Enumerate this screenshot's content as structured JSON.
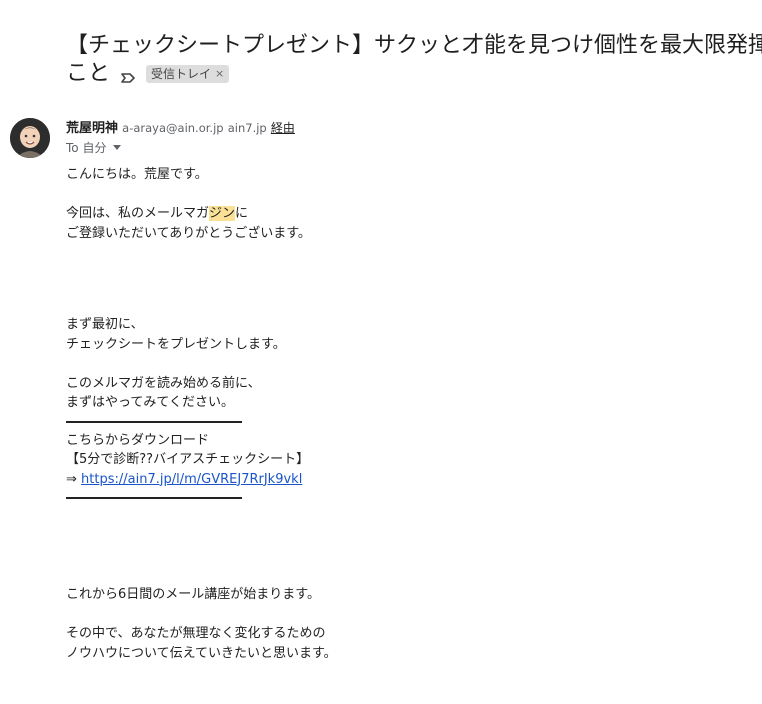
{
  "email": {
    "subject_line1": "【チェックシートプレゼント】サクッと才能を見つけ個性を最大限発揮",
    "subject_line2": "こと",
    "label": "受信トレイ",
    "label_close": "×",
    "sender": {
      "name": "荒屋明神",
      "email": "a-araya@ain.or.jp",
      "via_domain": "ain7.jp",
      "via_label": "経由"
    },
    "to_line": "To 自分",
    "body": {
      "greeting": "こんにちは。荒屋です。",
      "p2_part1": "今回は、私のメールマガ",
      "p2_highlight": "ジン",
      "p2_part2": "に",
      "p2_line2": "ご登録いただいてありがとうございます。",
      "p3_line1": "まず最初に、",
      "p3_line2": "チェックシートをプレゼントします。",
      "p4_line1": "このメルマガを読み始める前に、",
      "p4_line2": "まずはやってみてください。",
      "download_line": "こちらからダウンロード",
      "download_title": "【5分で診断??バイアスチェックシート】",
      "arrow": "⇒",
      "download_url": "https://ain7.jp/l/m/GVREJ7RrJk9vkl",
      "p5": "これから6日間のメール講座が始まります。",
      "p6_line1": "その中で、あなたが無理なく変化するための",
      "p6_line2": "ノウハウについて伝えていきたいと思います。"
    }
  }
}
